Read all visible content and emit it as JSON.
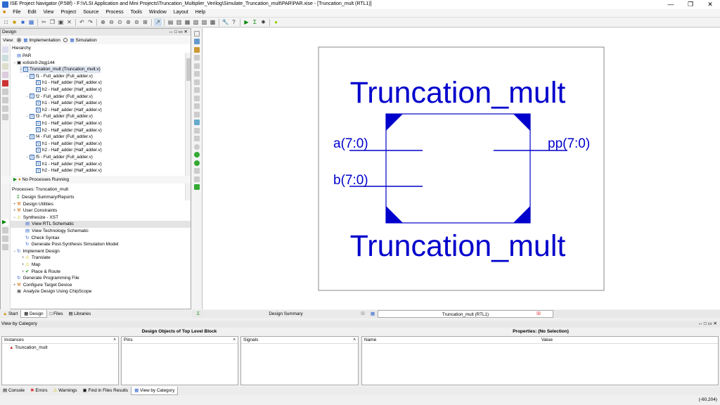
{
  "window": {
    "title": "ISE Project Navigator (P.58f) - F:\\VLSI Application and Mini Projects\\Truncation_Multiplier_Verilog\\Simulate_Truncation_mult\\PAR\\PAR.xise - [Truncation_mult (RTL1)]",
    "controls": [
      "—",
      "❐",
      "✕"
    ]
  },
  "menu": [
    "File",
    "Edit",
    "View",
    "Project",
    "Source",
    "Process",
    "Tools",
    "Window",
    "Layout",
    "Help"
  ],
  "design_panel": {
    "title": "Design",
    "view_label": "View:",
    "impl_label": "Implementation",
    "sim_label": "Simulation",
    "hierarchy_label": "Hierarchy",
    "tree": [
      {
        "indent": 0,
        "icon": "file",
        "text": "PAR"
      },
      {
        "indent": 0,
        "icon": "chip",
        "expander": "−",
        "text": "xc6slx9-2tqg144"
      },
      {
        "indent": 1,
        "icon": "v",
        "expander": "−",
        "text": "Truncation_mult (Truncation_mult.v)",
        "selected": true
      },
      {
        "indent": 2,
        "icon": "v",
        "expander": "−",
        "text": "f1 - Full_adder (Full_adder.v)"
      },
      {
        "indent": 3,
        "icon": "v",
        "text": "h1 - Half_adder (Half_adder.v)"
      },
      {
        "indent": 3,
        "icon": "v",
        "text": "h2 - Half_adder (Half_adder.v)"
      },
      {
        "indent": 2,
        "icon": "v",
        "expander": "−",
        "text": "f2 - Full_adder (Full_adder.v)"
      },
      {
        "indent": 3,
        "icon": "v",
        "text": "h1 - Half_adder (Half_adder.v)"
      },
      {
        "indent": 3,
        "icon": "v",
        "text": "h2 - Half_adder (Half_adder.v)"
      },
      {
        "indent": 2,
        "icon": "v",
        "expander": "−",
        "text": "f3 - Full_adder (Full_adder.v)"
      },
      {
        "indent": 3,
        "icon": "v",
        "text": "h1 - Half_adder (Half_adder.v)"
      },
      {
        "indent": 3,
        "icon": "v",
        "text": "h2 - Half_adder (Half_adder.v)"
      },
      {
        "indent": 2,
        "icon": "v",
        "expander": "−",
        "text": "f4 - Full_adder (Full_adder.v)"
      },
      {
        "indent": 3,
        "icon": "v",
        "text": "h1 - Half_adder (Half_adder.v)"
      },
      {
        "indent": 3,
        "icon": "v",
        "text": "h2 - Half_adder (Half_adder.v)"
      },
      {
        "indent": 2,
        "icon": "v",
        "expander": "−",
        "text": "f5 - Full_adder (Full_adder.v)"
      },
      {
        "indent": 3,
        "icon": "v",
        "text": "h1 - Half_adder (Half_adder.v)"
      },
      {
        "indent": 3,
        "icon": "v",
        "text": "h2 - Half_adder (Half_adder.v)"
      }
    ],
    "status": "No Processes Running",
    "processes_label": "Processes: Truncation_mult",
    "processes": [
      {
        "indent": 1,
        "text": "Design Summary/Reports",
        "icon": "sum"
      },
      {
        "indent": 1,
        "text": "Design Utilities",
        "expander": "+",
        "icon": "tool"
      },
      {
        "indent": 1,
        "text": "User Constraints",
        "expander": "+",
        "icon": "tool"
      },
      {
        "indent": 1,
        "text": "Synthesize - XST",
        "expander": "−",
        "icon": "warn"
      },
      {
        "indent": 2,
        "text": "View RTL Schematic",
        "icon": "doc",
        "selected": true
      },
      {
        "indent": 2,
        "text": "View Technology Schematic",
        "icon": "doc"
      },
      {
        "indent": 2,
        "text": "Check Syntax",
        "icon": "run"
      },
      {
        "indent": 2,
        "text": "Generate Post-Synthesis Simulation Model",
        "icon": "run"
      },
      {
        "indent": 1,
        "text": "Implement Design",
        "expander": "−",
        "icon": "run"
      },
      {
        "indent": 2,
        "text": "Translate",
        "expander": "+",
        "icon": "warn"
      },
      {
        "indent": 2,
        "text": "Map",
        "expander": "+",
        "icon": "warn"
      },
      {
        "indent": 2,
        "text": "Place & Route",
        "expander": "+",
        "icon": "ok"
      },
      {
        "indent": 1,
        "text": "Generate Programming File",
        "icon": "run"
      },
      {
        "indent": 1,
        "text": "Configure Target Device",
        "expander": "+",
        "icon": "tool"
      },
      {
        "indent": 1,
        "text": "Analyze Design Using ChipScope",
        "icon": "chip"
      }
    ],
    "bottom_tabs": [
      "Start",
      "Design",
      "Files",
      "Libraries"
    ]
  },
  "schematic": {
    "module_name_top": "Truncation_mult",
    "module_name_bottom": "Truncation_mult",
    "port_a": "a(7:0)",
    "port_b": "b(7:0)",
    "port_pp": "pp(7:0)",
    "color": "#0000cc"
  },
  "doc_tabs": {
    "summary": "Design Summary",
    "rtl": "Truncation_mult (RTL1)"
  },
  "bottom": {
    "view_by_category": "View by Category",
    "design_objects_title": "Design Objects of Top Level Block",
    "properties_title": "Properties: (No Selection)",
    "instances_header": "Instances",
    "instance_item": "Truncation_mult",
    "pins_header": "Pins",
    "signals_header": "Signals",
    "name_header": "Name",
    "value_header": "Value"
  },
  "console_tabs": [
    "Console",
    "Errors",
    "Warnings",
    "Find in Files Results",
    "View by Category"
  ],
  "status": {
    "coords": "(-60,204)"
  }
}
